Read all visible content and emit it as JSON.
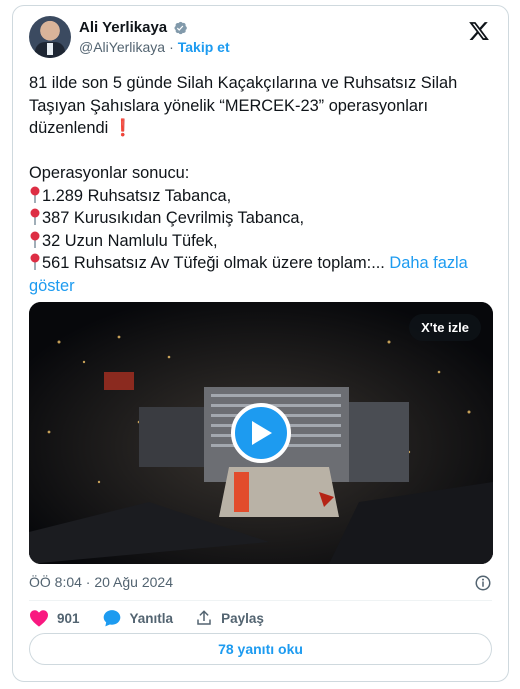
{
  "author": {
    "name": "Ali Yerlikaya",
    "handle": "@AliYerlikaya",
    "separator": "·",
    "follow_label": "Takip et"
  },
  "tweet": {
    "line1": "81 ilde son 5 günde Silah Kaçakçılarına ve Ruhsatsız Silah Taşıyan Şahıslara yönelik “MERCEK-23” operasyonları düzenlendi ",
    "exclamation": "❗",
    "results_heading": "Operasyonlar sonucu:",
    "items": [
      "1.289 Ruhsatsız Tabanca,",
      "387 Kurusıkıdan Çevrilmiş Tabanca,",
      "32 Uzun Namlulu Tüfek,",
      "561 Ruhsatsız Av Tüfeği olmak üzere toplam:..."
    ],
    "show_more": " Daha fazla göster"
  },
  "media": {
    "watch_label": "X'te izle"
  },
  "meta": {
    "timestamp": "ÖÖ 8:04 · 20 Ağu 2024"
  },
  "actions": {
    "likes": "901",
    "reply_label": "Yanıtla",
    "share_label": "Paylaş"
  },
  "read_replies": "78 yanıtı oku",
  "colors": {
    "accent": "#1d9bf0",
    "like": "#f91880",
    "text": "#0f1419",
    "muted": "#536471"
  }
}
